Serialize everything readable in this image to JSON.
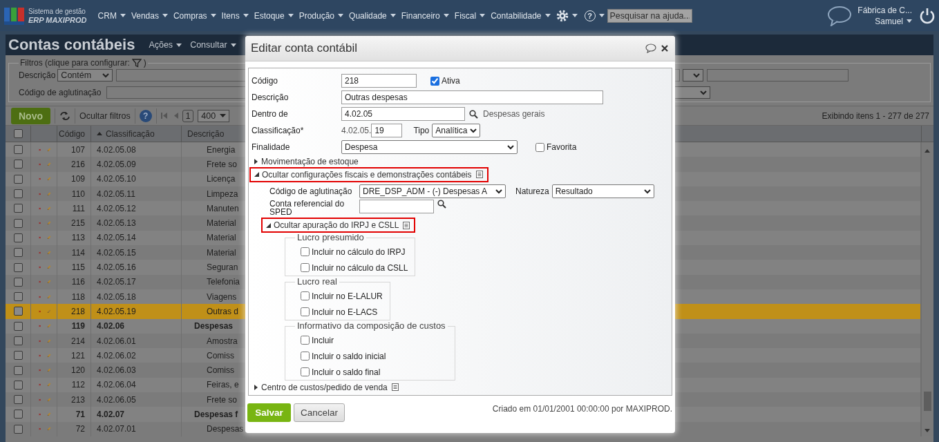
{
  "top_nav": {
    "logo_line1": "Sistema de gestão",
    "logo_line2": "ERP MAXIPROD",
    "menus": [
      "CRM",
      "Vendas",
      "Compras",
      "Itens",
      "Estoque",
      "Produção",
      "Qualidade",
      "Financeiro",
      "Fiscal",
      "Contabilidade"
    ],
    "help_label": "?",
    "search": {
      "placeholder": "Pesquisar na ajuda..."
    },
    "company": "Fábrica de C...",
    "user": "Samuel"
  },
  "page": {
    "title": "Contas contábeis",
    "menus": [
      "Ações",
      "Consultar"
    ]
  },
  "filters": {
    "legend": "Filtros (clique para configurar:",
    "legend_end": ")",
    "fields": [
      {
        "label": "Descrição",
        "operator": "Contém"
      },
      {
        "label": "Código de aglutinação"
      }
    ]
  },
  "toolbar": {
    "new_button": "Novo",
    "hide_filters": "Ocultar filtros",
    "help_label": "?",
    "page": "1",
    "page_size": "400",
    "status": "Exibindo itens 1 - 277 de 277"
  },
  "table": {
    "header_checked": false,
    "columns": [
      {
        "label": "Código"
      },
      {
        "label": "Classificação",
        "sorted": true
      },
      {
        "label": "Descrição"
      }
    ],
    "rows": [
      {
        "code": "107",
        "classification": "4.02.05.08",
        "description": "Energia",
        "kind": "account",
        "selected": false,
        "checked": false
      },
      {
        "code": "216",
        "classification": "4.02.05.09",
        "description": "Frete so",
        "kind": "account",
        "selected": false,
        "checked": false
      },
      {
        "code": "109",
        "classification": "4.02.05.10",
        "description": "Licença",
        "kind": "account",
        "selected": false,
        "checked": false
      },
      {
        "code": "110",
        "classification": "4.02.05.11",
        "description": "Limpeza",
        "kind": "account",
        "selected": false,
        "checked": false
      },
      {
        "code": "111",
        "classification": "4.02.05.12",
        "description": "Manuten",
        "kind": "account",
        "selected": false,
        "checked": false
      },
      {
        "code": "215",
        "classification": "4.02.05.13",
        "description": "Material",
        "kind": "account",
        "selected": false,
        "checked": false
      },
      {
        "code": "113",
        "classification": "4.02.05.14",
        "description": "Material",
        "kind": "account",
        "selected": false,
        "checked": false
      },
      {
        "code": "114",
        "classification": "4.02.05.15",
        "description": "Material",
        "kind": "account",
        "selected": false,
        "checked": false
      },
      {
        "code": "115",
        "classification": "4.02.05.16",
        "description": "Seguran",
        "kind": "account",
        "selected": false,
        "checked": false
      },
      {
        "code": "116",
        "classification": "4.02.05.17",
        "description": "Telefonia",
        "kind": "account",
        "selected": false,
        "checked": false
      },
      {
        "code": "118",
        "classification": "4.02.05.18",
        "description": "Viagens",
        "kind": "account",
        "selected": false,
        "checked": false
      },
      {
        "code": "218",
        "classification": "4.02.05.19",
        "description": "Outras d",
        "kind": "account",
        "selected": true,
        "checked": false
      },
      {
        "code": "119",
        "classification": "4.02.06",
        "description": "Despesas",
        "kind": "group",
        "selected": false,
        "checked": false
      },
      {
        "code": "214",
        "classification": "4.02.06.01",
        "description": "Amostra",
        "kind": "account",
        "selected": false,
        "checked": false
      },
      {
        "code": "121",
        "classification": "4.02.06.02",
        "description": "Comiss",
        "kind": "account",
        "selected": false,
        "checked": false
      },
      {
        "code": "120",
        "classification": "4.02.06.03",
        "description": "Comiss",
        "kind": "account",
        "selected": false,
        "checked": false
      },
      {
        "code": "112",
        "classification": "4.02.06.04",
        "description": "Feiras, e",
        "kind": "account",
        "selected": false,
        "checked": false
      },
      {
        "code": "213",
        "classification": "4.02.06.05",
        "description": "Frete so",
        "kind": "account",
        "selected": false,
        "checked": false
      },
      {
        "code": "71",
        "classification": "4.02.07",
        "description": "Despesas f",
        "kind": "group",
        "selected": false,
        "checked": false
      },
      {
        "code": "72",
        "classification": "4.02.07.01",
        "description": "Despesas",
        "kind": "account",
        "selected": false,
        "checked": false
      }
    ]
  },
  "modal": {
    "title": "Editar conta contábil",
    "code": {
      "label": "Código",
      "value": "218"
    },
    "active": {
      "label": "Ativa",
      "checked": true
    },
    "description": {
      "label": "Descrição",
      "value": "Outras despesas"
    },
    "parent": {
      "label": "Dentro de",
      "value": "4.02.05",
      "name": "Despesas gerais"
    },
    "classification": {
      "label": "Classificação*",
      "prefix": "4.02.05.",
      "value": "19"
    },
    "type": {
      "label": "Tipo",
      "value": "Analítica"
    },
    "purpose": {
      "label": "Finalidade",
      "value": "Despesa"
    },
    "favorite": {
      "label": "Favorita",
      "checked": false
    },
    "sections": [
      {
        "label": "Movimentação de estoque",
        "expanded": false,
        "highlighted": false,
        "note_icon": false
      },
      {
        "label": "Ocultar configurações fiscais e demonstrações contábeis",
        "expanded": true,
        "highlighted": true,
        "note_icon": true,
        "agglutination": {
          "label": "Código de aglutinação",
          "value": "DRE_DSP_ADM - (-) Despesas A"
        },
        "nature": {
          "label": "Natureza",
          "value": "Resultado"
        },
        "sped": {
          "label": "Conta referencial do SPED"
        },
        "subsection": {
          "label": "Ocultar apuração do IRPJ e CSLL",
          "expanded": true,
          "highlighted": true,
          "note_icon": true,
          "groups": [
            {
              "legend": "Lucro presumido",
              "options": [
                {
                  "label": "Incluir no cálculo do IRPJ",
                  "checked": false
                },
                {
                  "label": "Incluir no cálculo da CSLL",
                  "checked": false
                }
              ]
            },
            {
              "legend": "Lucro real",
              "options": [
                {
                  "label": "Incluir no E-LALUR",
                  "checked": false
                },
                {
                  "label": "Incluir no E-LACS",
                  "checked": false
                }
              ]
            },
            {
              "legend": "Informativo da composição de custos",
              "options": [
                {
                  "label": "Incluir",
                  "checked": false
                },
                {
                  "label": "Incluir o saldo inicial",
                  "checked": false
                },
                {
                  "label": "Incluir o saldo final",
                  "checked": false
                }
              ]
            }
          ]
        }
      },
      {
        "label": "Centro de custos/pedido de venda",
        "expanded": false,
        "highlighted": false,
        "note_icon": true
      }
    ],
    "buttons": [
      {
        "label": "Salvar",
        "kind": "primary"
      },
      {
        "label": "Cancelar",
        "kind": "secondary"
      }
    ],
    "created": "Criado em 01/01/2001 00:00:00 por MAXIPROD."
  }
}
